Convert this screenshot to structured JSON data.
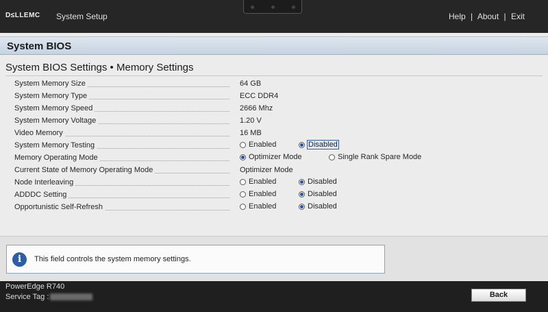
{
  "topbar": {
    "logo": "D≤LLEMC",
    "app_title": "System Setup",
    "nav": {
      "help": "Help",
      "about": "About",
      "exit": "Exit",
      "separator": "|"
    }
  },
  "section": {
    "title": "System BIOS"
  },
  "page": {
    "title": "System BIOS Settings • Memory Settings"
  },
  "settings": [
    {
      "label": "System Memory Size",
      "value": "64 GB"
    },
    {
      "label": "System Memory Type",
      "value": "ECC DDR4"
    },
    {
      "label": "System Memory Speed",
      "value": "2666 Mhz"
    },
    {
      "label": "System Memory Voltage",
      "value": "1.20 V"
    },
    {
      "label": "Video Memory",
      "value": "16 MB"
    },
    {
      "label": "System Memory Testing",
      "options": [
        "Enabled",
        "Disabled"
      ],
      "selected": "Disabled",
      "focused": "Disabled"
    },
    {
      "label": "Memory Operating Mode",
      "options": [
        "Optimizer Mode",
        "Single Rank Spare Mode"
      ],
      "selected": "Optimizer Mode"
    },
    {
      "label": "Current State of Memory Operating Mode",
      "value": "Optimizer Mode"
    },
    {
      "label": "Node Interleaving",
      "options": [
        "Enabled",
        "Disabled"
      ],
      "selected": "Disabled"
    },
    {
      "label": "ADDDC Setting",
      "options": [
        "Enabled",
        "Disabled"
      ],
      "selected": "Disabled"
    },
    {
      "label": "Opportunistic Self-Refresh",
      "options": [
        "Enabled",
        "Disabled"
      ],
      "selected": "Disabled"
    }
  ],
  "help": {
    "icon": "info-icon",
    "text": "This field controls the system memory settings."
  },
  "footer": {
    "model": "PowerEdge R740",
    "service_tag_label": "Service Tag :",
    "back_label": "Back"
  }
}
